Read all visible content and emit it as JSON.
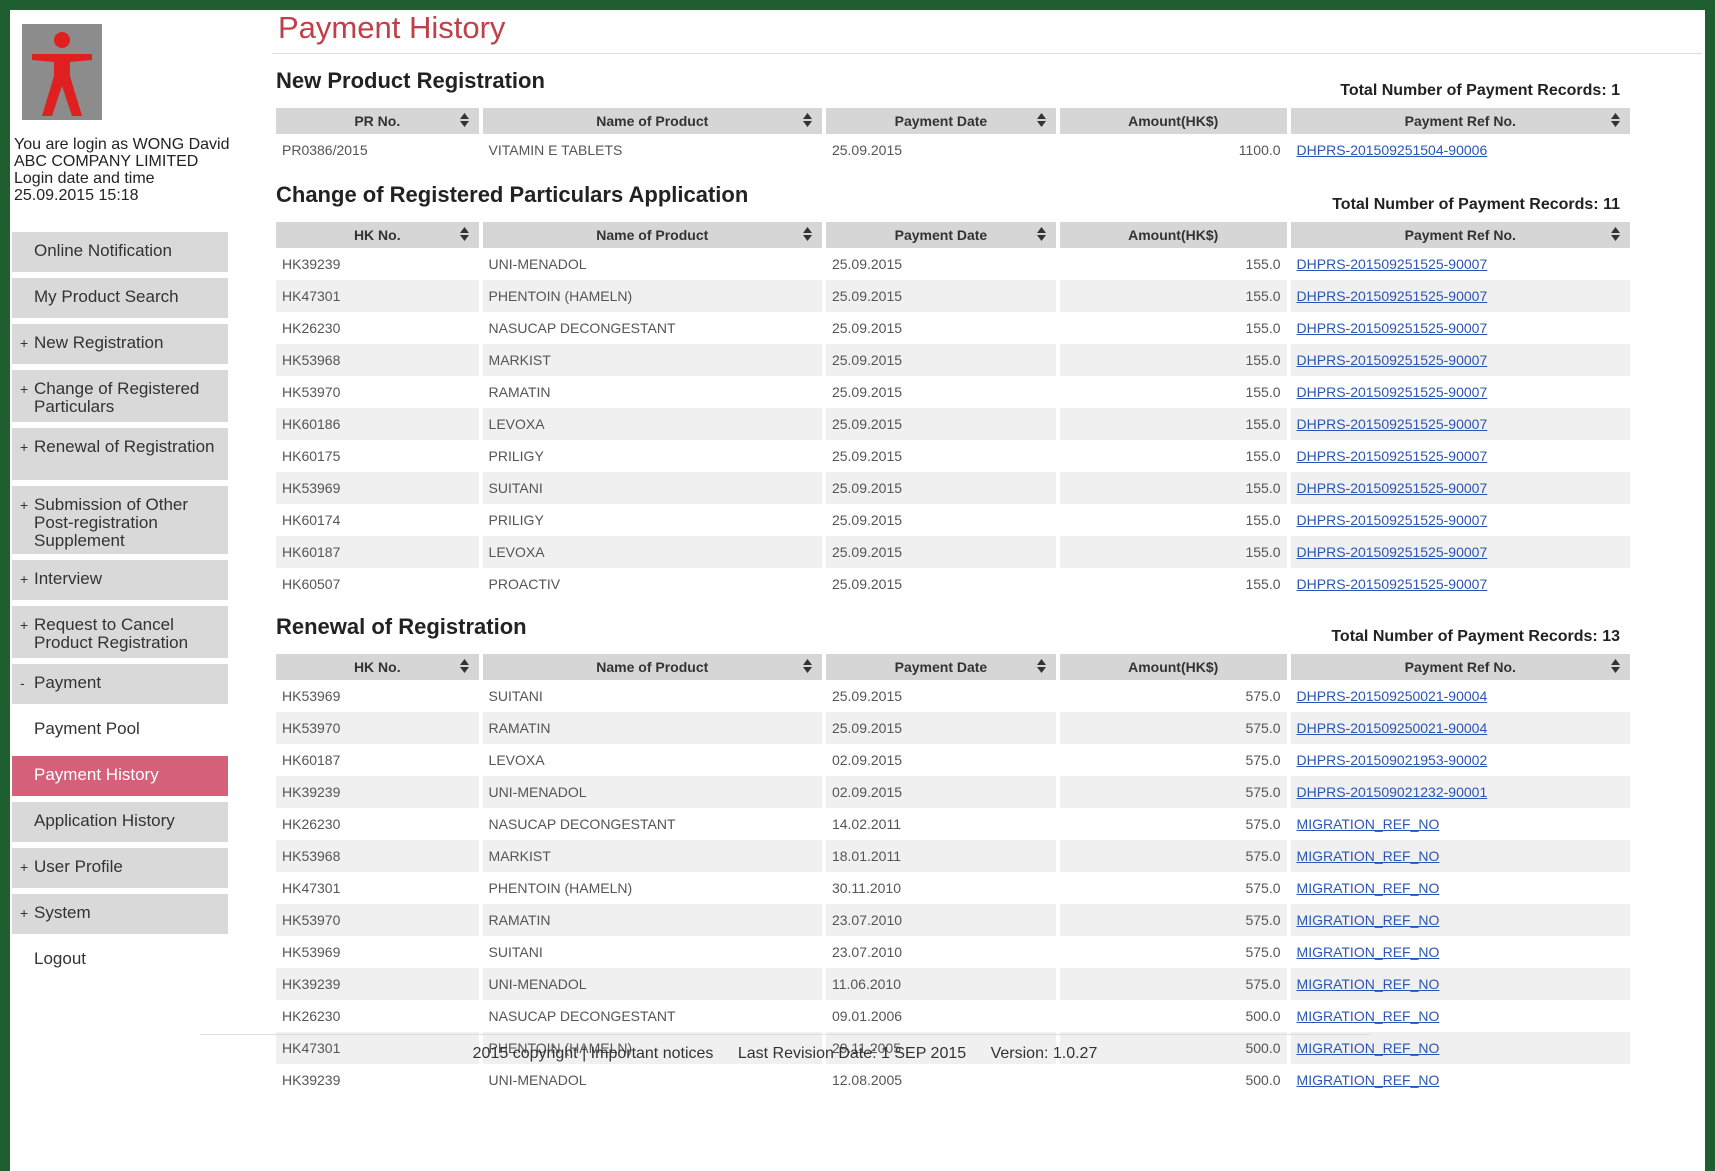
{
  "page": {
    "title": "Payment History"
  },
  "user": {
    "login_text": "You are login as WONG David",
    "company": "ABC COMPANY LIMITED",
    "login_label": "Login date and time",
    "login_time": "25.09.2015 15:18"
  },
  "nav": [
    {
      "label": "Online Notification",
      "prefix": ""
    },
    {
      "label": "My Product Search",
      "prefix": ""
    },
    {
      "label": "New Registration",
      "prefix": "+"
    },
    {
      "label": "Change of Registered Particulars",
      "prefix": "+"
    },
    {
      "label": "Renewal of Registration",
      "prefix": "+"
    },
    {
      "label": "Submission of Other Post-registration Supplement",
      "prefix": "+"
    },
    {
      "label": "Interview",
      "prefix": "+"
    },
    {
      "label": "Request to Cancel Product Registration",
      "prefix": "+"
    },
    {
      "label": "Payment",
      "prefix": "-"
    },
    {
      "label": "Payment Pool",
      "prefix": ""
    },
    {
      "label": "Payment History",
      "prefix": ""
    },
    {
      "label": "Application History",
      "prefix": ""
    },
    {
      "label": "User Profile",
      "prefix": "+"
    },
    {
      "label": "System",
      "prefix": "+"
    },
    {
      "label": "Logout",
      "prefix": ""
    }
  ],
  "sections": {
    "new_reg": {
      "title": "New Product Registration",
      "total": "Total Number of Payment Records: 1",
      "headers": [
        "PR No.",
        "Name of Product",
        "Payment Date",
        "Amount(HK$)",
        "Payment Ref No."
      ],
      "rows": [
        [
          "PR0386/2015",
          "VITAMIN E TABLETS",
          "25.09.2015",
          "1100.0",
          "DHPRS-201509251504-90006"
        ]
      ]
    },
    "change": {
      "title": "Change of Registered Particulars Application",
      "total": "Total Number of Payment Records: 11",
      "headers": [
        "HK No.",
        "Name of Product",
        "Payment Date",
        "Amount(HK$)",
        "Payment Ref No."
      ],
      "rows": [
        [
          "HK39239",
          "UNI-MENADOL",
          "25.09.2015",
          "155.0",
          "DHPRS-201509251525-90007"
        ],
        [
          "HK47301",
          "PHENTOIN (HAMELN)",
          "25.09.2015",
          "155.0",
          "DHPRS-201509251525-90007"
        ],
        [
          "HK26230",
          "NASUCAP DECONGESTANT",
          "25.09.2015",
          "155.0",
          "DHPRS-201509251525-90007"
        ],
        [
          "HK53968",
          "MARKIST",
          "25.09.2015",
          "155.0",
          "DHPRS-201509251525-90007"
        ],
        [
          "HK53970",
          "RAMATIN",
          "25.09.2015",
          "155.0",
          "DHPRS-201509251525-90007"
        ],
        [
          "HK60186",
          "LEVOXA",
          "25.09.2015",
          "155.0",
          "DHPRS-201509251525-90007"
        ],
        [
          "HK60175",
          "PRILIGY",
          "25.09.2015",
          "155.0",
          "DHPRS-201509251525-90007"
        ],
        [
          "HK53969",
          "SUITANI",
          "25.09.2015",
          "155.0",
          "DHPRS-201509251525-90007"
        ],
        [
          "HK60174",
          "PRILIGY",
          "25.09.2015",
          "155.0",
          "DHPRS-201509251525-90007"
        ],
        [
          "HK60187",
          "LEVOXA",
          "25.09.2015",
          "155.0",
          "DHPRS-201509251525-90007"
        ],
        [
          "HK60507",
          "PROACTIV",
          "25.09.2015",
          "155.0",
          "DHPRS-201509251525-90007"
        ]
      ]
    },
    "renewal": {
      "title": "Renewal of Registration",
      "total": "Total Number of Payment Records: 13",
      "headers": [
        "HK No.",
        "Name of Product",
        "Payment Date",
        "Amount(HK$)",
        "Payment Ref No."
      ],
      "rows": [
        [
          "HK53969",
          "SUITANI",
          "25.09.2015",
          "575.0",
          "DHPRS-201509250021-90004"
        ],
        [
          "HK53970",
          "RAMATIN",
          "25.09.2015",
          "575.0",
          "DHPRS-201509250021-90004"
        ],
        [
          "HK60187",
          "LEVOXA",
          "02.09.2015",
          "575.0",
          "DHPRS-201509021953-90002"
        ],
        [
          "HK39239",
          "UNI-MENADOL",
          "02.09.2015",
          "575.0",
          "DHPRS-201509021232-90001"
        ],
        [
          "HK26230",
          "NASUCAP DECONGESTANT",
          "14.02.2011",
          "575.0",
          "MIGRATION_REF_NO"
        ],
        [
          "HK53968",
          "MARKIST",
          "18.01.2011",
          "575.0",
          "MIGRATION_REF_NO"
        ],
        [
          "HK47301",
          "PHENTOIN (HAMELN)",
          "30.11.2010",
          "575.0",
          "MIGRATION_REF_NO"
        ],
        [
          "HK53970",
          "RAMATIN",
          "23.07.2010",
          "575.0",
          "MIGRATION_REF_NO"
        ],
        [
          "HK53969",
          "SUITANI",
          "23.07.2010",
          "575.0",
          "MIGRATION_REF_NO"
        ],
        [
          "HK39239",
          "UNI-MENADOL",
          "11.06.2010",
          "575.0",
          "MIGRATION_REF_NO"
        ],
        [
          "HK26230",
          "NASUCAP DECONGESTANT",
          "09.01.2006",
          "500.0",
          "MIGRATION_REF_NO"
        ],
        [
          "HK47301",
          "PHENTOIN (HAMELN)",
          "29.11.2005",
          "500.0",
          "MIGRATION_REF_NO"
        ],
        [
          "HK39239",
          "UNI-MENADOL",
          "12.08.2005",
          "500.0",
          "MIGRATION_REF_NO"
        ]
      ]
    }
  },
  "footer": {
    "copyright": "2015 copyright | Important notices",
    "revision": "Last Revision Date: 1 SEP 2015",
    "version": "Version: 1.0.27"
  },
  "colors": {
    "active_nav": "#d4607a",
    "title": "#c0404a",
    "link": "#2a55b8",
    "frame": "#1f5f2f"
  },
  "icons": {
    "sort": "sort-arrows-icon",
    "logo": "logo-icon"
  }
}
